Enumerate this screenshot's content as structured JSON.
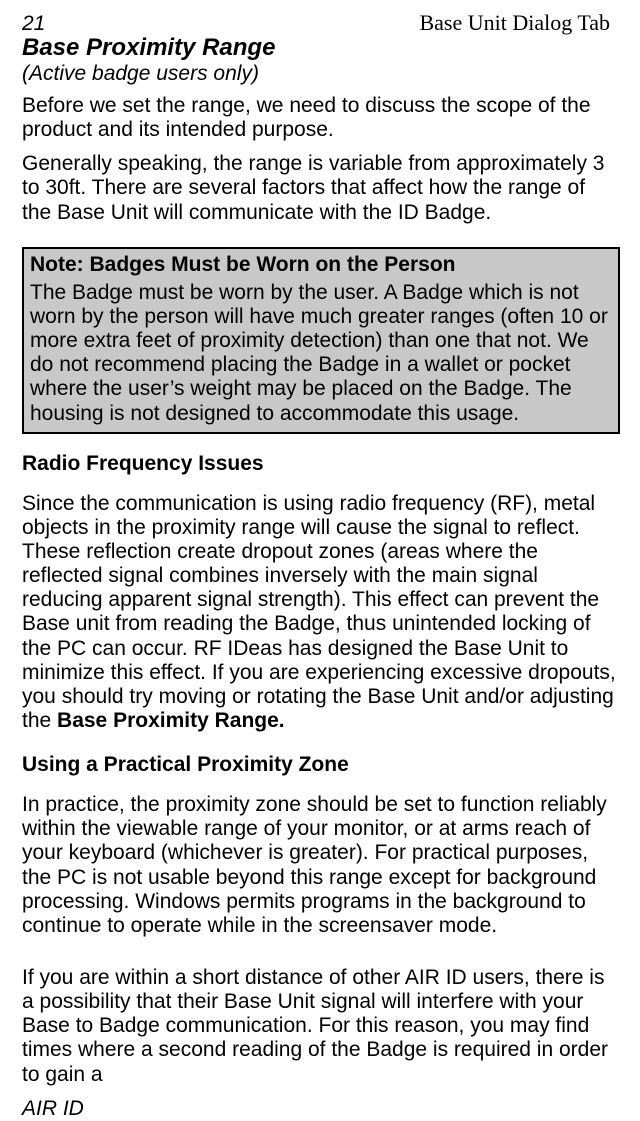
{
  "header": {
    "page_number": "21",
    "right_text": "Base Unit Dialog Tab"
  },
  "title": "Base Proximity Range",
  "subtitle": "(Active badge users only)",
  "intro_para_1": "Before we set the range, we need to discuss the scope of the product and its intended purpose.",
  "intro_para_2": "Generally speaking, the range is variable from approximately 3 to 30ft.  There are several factors that affect how the range of the Base Unit will communicate with the ID Badge.",
  "note": {
    "title": "Note: Badges Must be Worn on the Person",
    "body": "The Badge must be worn by the user.  A Badge which is not worn by the person will have much greater ranges (often 10 or more extra feet of proximity detection) than one that not.   We do not recommend placing the Badge in a wallet or pocket where the user’s weight may be placed on the Badge.  The housing is not designed to accommodate this usage."
  },
  "section_rf": {
    "heading": "Radio Frequency Issues",
    "body_part1": "Since the communication is using radio frequency (RF), metal objects in the proximity range will cause the signal to reflect. These reflection create dropout zones (areas where the reflected signal combines inversely with the main signal reducing apparent signal strength). This effect can prevent the Base unit from reading the Badge, thus unintended locking of the PC can occur. RF IDeas has designed the Base Unit to minimize this effect.  If you are experiencing excessive dropouts, you should try moving or rotating the Base Unit and/or adjusting the ",
    "body_bold": "Base Proximity Range."
  },
  "section_zone": {
    "heading": "Using a Practical Proximity Zone",
    "body1": "In practice, the proximity zone should be set to function reliably within the viewable range of your monitor, or at arms reach of your keyboard (whichever is greater). For practical purposes, the PC is not usable beyond this range except for background processing. Windows permits programs in the background to continue to operate while in the screensaver mode.",
    "body2": "If you are within a short distance of other AIR ID users, there is a possibility that their Base Unit signal will interfere with your Base to Badge communication.   For this reason, you may find times where a second reading of the Badge is required in order to gain a"
  },
  "footer": "AIR ID"
}
